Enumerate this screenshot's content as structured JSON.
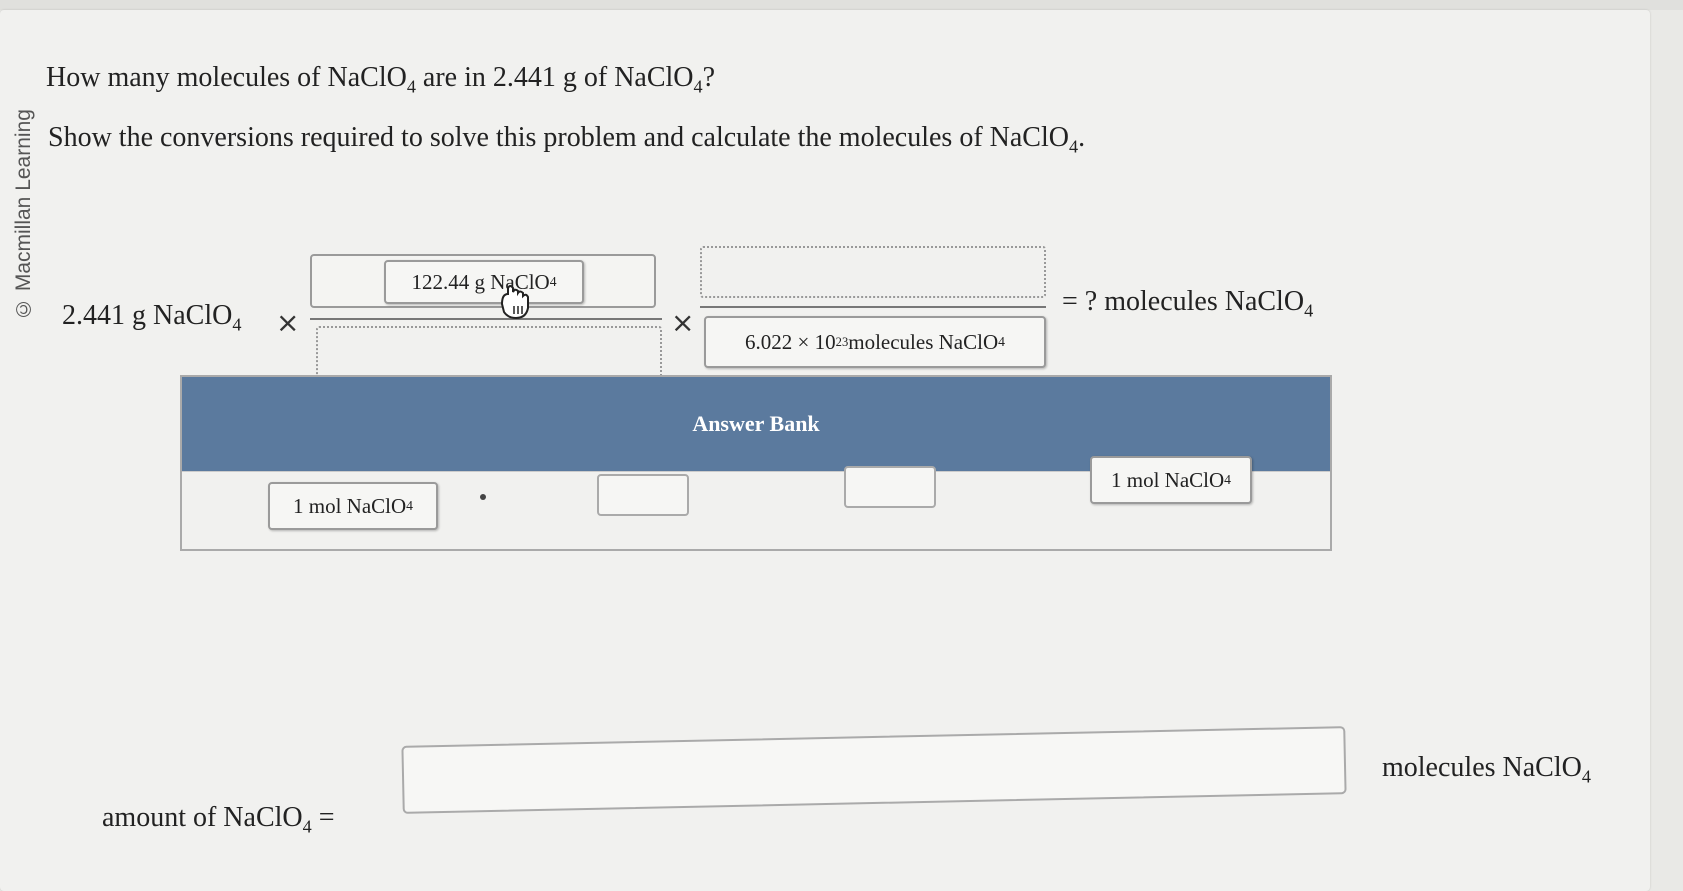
{
  "credit": "© Macmillan Learning",
  "question": {
    "line1_prefix": "How many molecules of NaClO",
    "line1_sub1": "4",
    "line1_mid": " are in 2.441 g of NaClO",
    "line1_sub2": "4",
    "line1_end": "?",
    "line2_prefix": "Show the conversions required to solve this problem and calculate the molecules of NaClO",
    "line2_sub": "4",
    "line2_end": "."
  },
  "equation": {
    "start_text": "2.441 g NaClO",
    "start_sub": "4",
    "times": "×",
    "frac1_numerator": {
      "text": "122.44 g NaClO",
      "sub": "4"
    },
    "frac2_denominator": {
      "text": "6.022 × 10",
      "sup": "23",
      "rest": " molecules NaClO",
      "sub": "4"
    },
    "result_text": "= ? molecules NaClO",
    "result_sub": "4"
  },
  "answer_bank": {
    "title": "Answer Bank",
    "tiles": [
      {
        "text": "1 mol NaClO",
        "sub": "4"
      },
      {
        "text": "1 mol NaClO",
        "sub": "4"
      }
    ]
  },
  "answer": {
    "label": "amount of NaClO",
    "label_sub": "4",
    "equals": "=",
    "value": "",
    "unit": "molecules NaClO",
    "unit_sub": "4"
  }
}
